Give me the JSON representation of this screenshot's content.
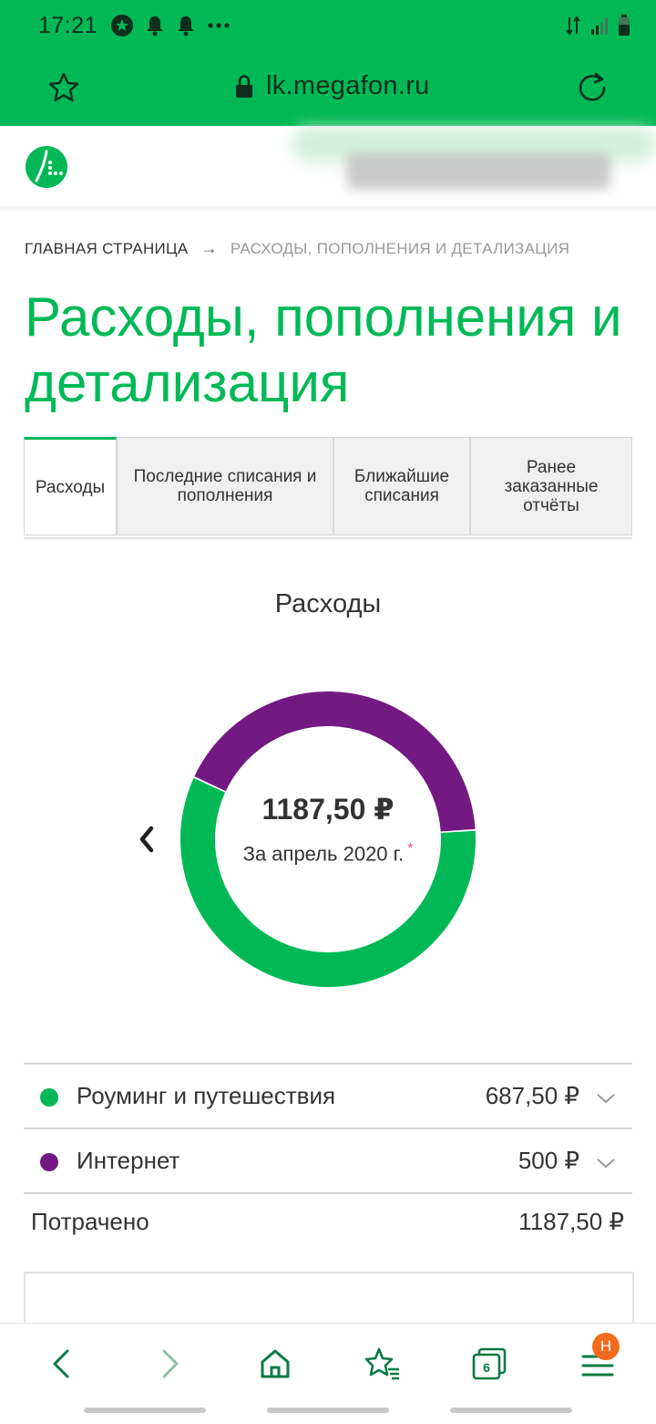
{
  "status_bar": {
    "time": "17:21",
    "icons": [
      "star-circle-icon",
      "bell-icon",
      "bell-icon",
      "more-dots-icon"
    ],
    "right_icons": [
      "data-arrows-icon",
      "signal-icon",
      "battery-icon"
    ]
  },
  "browser": {
    "url": "lk.megafon.ru",
    "open_tabs": "6",
    "menu_badge": "H"
  },
  "site": {
    "logo": "megafon-logo-icon"
  },
  "breadcrumb": {
    "home": "ГЛАВНАЯ СТРАНИЦА",
    "separator": "→",
    "current": "РАСХОДЫ, ПОПОЛНЕНИЯ И ДЕТАЛИЗАЦИЯ"
  },
  "page_title": "Расходы, пополнения и детализация",
  "tabs": [
    {
      "label": "Расходы",
      "active": true
    },
    {
      "label": "Последние списания и пополнения",
      "active": false
    },
    {
      "label": "Ближайшие списания",
      "active": false
    },
    {
      "label": "Ранее заказанные отчёты",
      "active": false
    }
  ],
  "chart": {
    "title": "Расходы",
    "total": "1187,50 ₽",
    "period": "За апрель 2020 г.",
    "asterisk": "*"
  },
  "chart_data": {
    "type": "pie",
    "categories": [
      "Роуминг и путешествия",
      "Интернет"
    ],
    "values": [
      687.5,
      500
    ],
    "colors": [
      "#00b956",
      "#731982"
    ]
  },
  "legend": [
    {
      "name": "Роуминг и путешествия",
      "value": "687,50 ₽",
      "color": "#00b956"
    },
    {
      "name": "Интернет",
      "value": "500 ₽",
      "color": "#731982"
    }
  ],
  "spent": {
    "label": "Потрачено",
    "value": "1187,50 ₽"
  },
  "colors": {
    "brand_green": "#00b956",
    "purple": "#731982",
    "badge_orange": "#f26a1b"
  }
}
